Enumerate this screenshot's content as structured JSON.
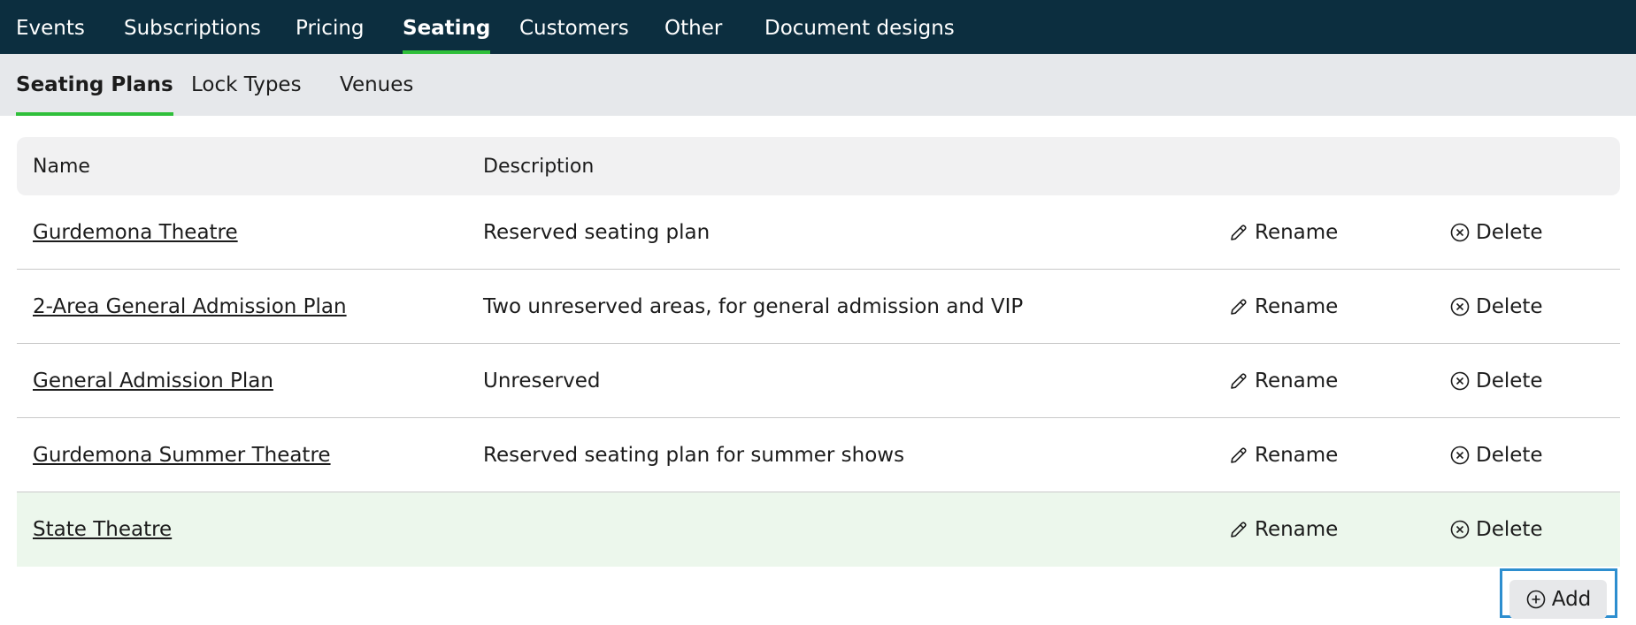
{
  "top_nav": {
    "items": [
      {
        "label": "Events"
      },
      {
        "label": "Subscriptions"
      },
      {
        "label": "Pricing"
      },
      {
        "label": "Seating",
        "active": true
      },
      {
        "label": "Customers"
      },
      {
        "label": "Other"
      },
      {
        "label": "Document designs"
      }
    ]
  },
  "sub_nav": {
    "items": [
      {
        "label": "Seating Plans",
        "active": true
      },
      {
        "label": "Lock Types"
      },
      {
        "label": "Venues"
      }
    ]
  },
  "table": {
    "columns": [
      "Name",
      "Description"
    ],
    "rows": [
      {
        "name": "Gurdemona Theatre",
        "description": "Reserved seating plan",
        "rename": "Rename",
        "delete": "Delete"
      },
      {
        "name": "2-Area General Admission Plan",
        "description": "Two unreserved areas, for general admission and VIP",
        "rename": "Rename",
        "delete": "Delete"
      },
      {
        "name": "General Admission Plan",
        "description": "Unreserved",
        "rename": "Rename",
        "delete": "Delete"
      },
      {
        "name": "Gurdemona Summer Theatre",
        "description": "Reserved seating plan for summer shows",
        "rename": "Rename",
        "delete": "Delete"
      },
      {
        "name": "State Theatre",
        "description": "",
        "rename": "Rename",
        "delete": "Delete",
        "highlighted": true
      }
    ]
  },
  "add_button": {
    "label": "Add"
  },
  "icons": {
    "rename": "pencil-icon",
    "delete": "circle-x-icon",
    "add": "circle-plus-icon"
  },
  "colors": {
    "nav_background": "#0c2e3f",
    "accent": "#2fbf3a",
    "subnav_background": "#e6e8eb",
    "highlight_row": "#ecf7ec",
    "focus_outline": "#2d8ecf"
  }
}
